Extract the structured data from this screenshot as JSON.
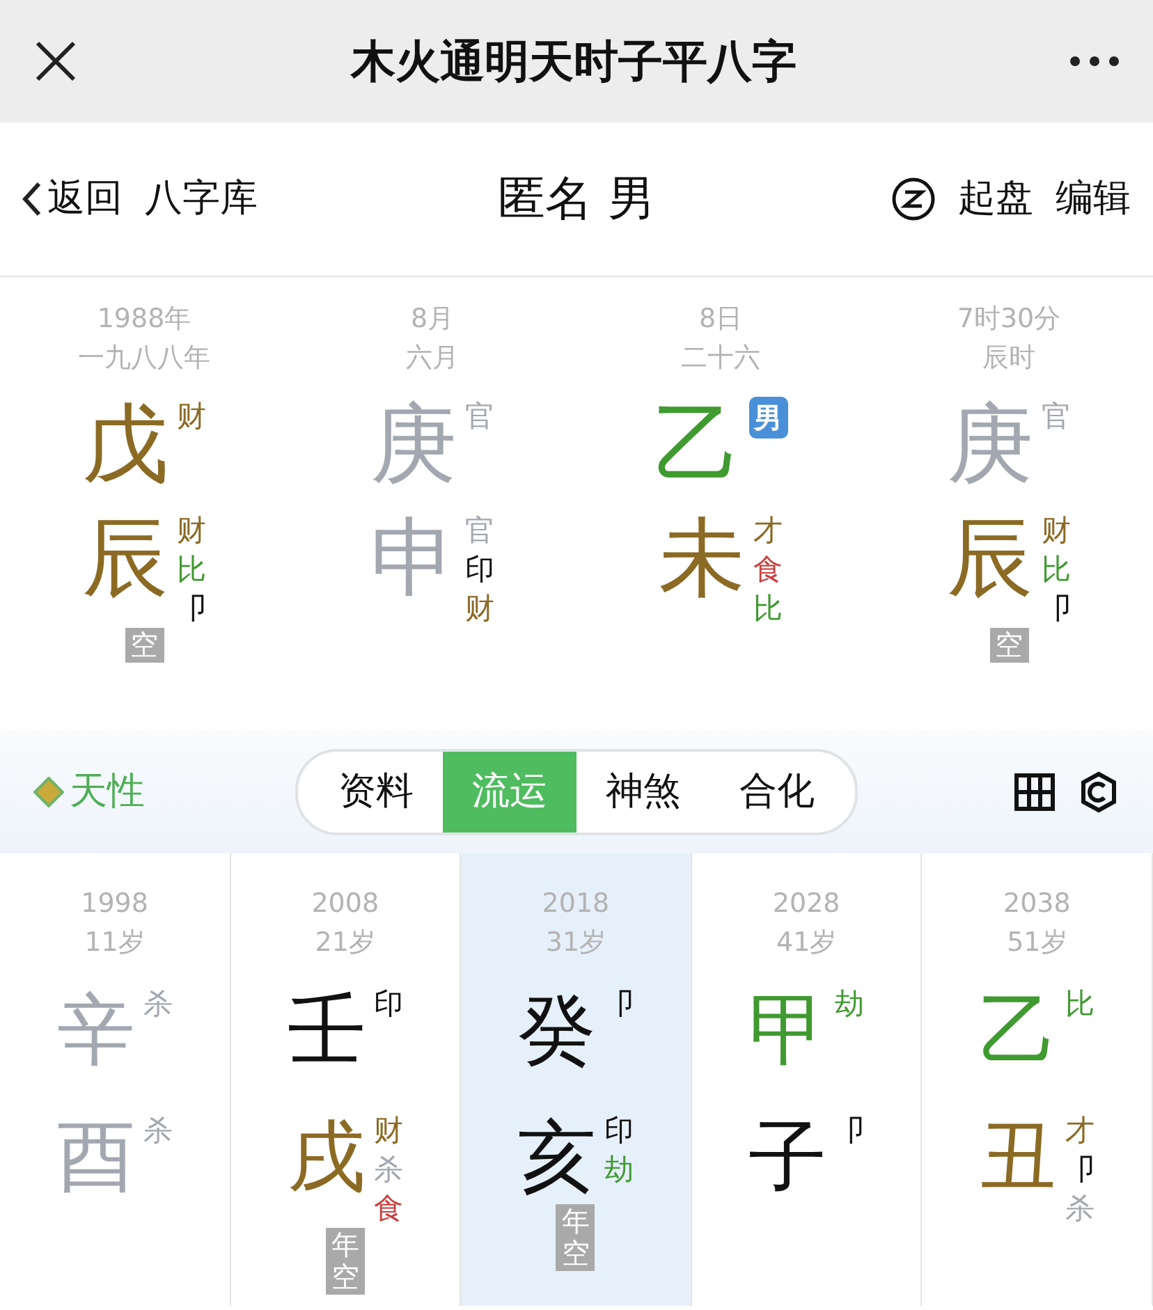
{
  "top_bar": {
    "title": "木火通明天时子平八字"
  },
  "nav": {
    "back": "返回",
    "library": "八字库",
    "title": "匿名 男",
    "actions": [
      "起盘",
      "编辑"
    ]
  },
  "pillars": [
    {
      "date": "1988年",
      "lunar": "一九八八年",
      "stem": {
        "char": "戊",
        "color": "#8b6a24",
        "gods": [
          {
            "text": "财",
            "color": "#8b6a24"
          }
        ]
      },
      "branch": {
        "char": "辰",
        "color": "#8b6a24",
        "gods": [
          {
            "text": "财",
            "color": "#8b6a24"
          },
          {
            "text": "比",
            "color": "#3f9a30"
          },
          {
            "text": "卩",
            "color": "#111111"
          }
        ]
      },
      "void": "空"
    },
    {
      "date": "8月",
      "lunar": "六月",
      "stem": {
        "char": "庚",
        "color": "#a3a8b0",
        "gods": [
          {
            "text": "官",
            "color": "#a3a8b0"
          }
        ]
      },
      "branch": {
        "char": "申",
        "color": "#a3a8b0",
        "gods": [
          {
            "text": "官",
            "color": "#a3a8b0"
          },
          {
            "text": "印",
            "color": "#111111"
          },
          {
            "text": "财",
            "color": "#8b6a24"
          }
        ]
      }
    },
    {
      "date": "8日",
      "lunar": "二十六",
      "stem": {
        "char": "乙",
        "color": "#3f9a30"
      },
      "badge": "男",
      "branch": {
        "char": "未",
        "color": "#8b6a24",
        "gods": [
          {
            "text": "才",
            "color": "#8b6a24"
          },
          {
            "text": "食",
            "color": "#c8403f"
          },
          {
            "text": "比",
            "color": "#3f9a30"
          }
        ]
      }
    },
    {
      "date": "7时30分",
      "lunar": "辰时",
      "stem": {
        "char": "庚",
        "color": "#a3a8b0",
        "gods": [
          {
            "text": "官",
            "color": "#a3a8b0"
          }
        ]
      },
      "branch": {
        "char": "辰",
        "color": "#8b6a24",
        "gods": [
          {
            "text": "财",
            "color": "#8b6a24"
          },
          {
            "text": "比",
            "color": "#3f9a30"
          },
          {
            "text": "卩",
            "color": "#111111"
          }
        ]
      },
      "void": "空"
    }
  ],
  "tab_bar": {
    "label": "天性",
    "tabs": [
      {
        "label": "资料",
        "selected": false
      },
      {
        "label": "流运",
        "selected": true
      },
      {
        "label": "神煞",
        "selected": false
      },
      {
        "label": "合化",
        "selected": false
      }
    ]
  },
  "luck": [
    {
      "year": "1998",
      "age": "11岁",
      "selected": false,
      "stem": {
        "char": "辛",
        "color": "#a3a8b0",
        "gods": [
          {
            "text": "杀",
            "color": "#a3a8b0"
          }
        ]
      },
      "branch": {
        "char": "酉",
        "color": "#a3a8b0",
        "gods": [
          {
            "text": "杀",
            "color": "#a3a8b0"
          }
        ]
      }
    },
    {
      "year": "2008",
      "age": "21岁",
      "selected": false,
      "stem": {
        "char": "壬",
        "color": "#111111",
        "gods": [
          {
            "text": "印",
            "color": "#111111"
          }
        ]
      },
      "branch": {
        "char": "戌",
        "color": "#8b6a24",
        "gods": [
          {
            "text": "财",
            "color": "#8b6a24"
          },
          {
            "text": "杀",
            "color": "#a3a8b0"
          },
          {
            "text": "食",
            "color": "#c8403f"
          }
        ]
      },
      "void": "年空"
    },
    {
      "year": "2018",
      "age": "31岁",
      "selected": true,
      "stem": {
        "char": "癸",
        "color": "#111111",
        "gods": [
          {
            "text": "卩",
            "color": "#111111"
          }
        ]
      },
      "branch": {
        "char": "亥",
        "color": "#111111",
        "gods": [
          {
            "text": "印",
            "color": "#111111"
          },
          {
            "text": "劫",
            "color": "#3f9a30"
          }
        ]
      },
      "void": "年空"
    },
    {
      "year": "2028",
      "age": "41岁",
      "selected": false,
      "stem": {
        "char": "甲",
        "color": "#3f9a30",
        "gods": [
          {
            "text": "劫",
            "color": "#3f9a30"
          }
        ]
      },
      "branch": {
        "char": "子",
        "color": "#111111",
        "gods": [
          {
            "text": "卩",
            "color": "#111111"
          }
        ]
      }
    },
    {
      "year": "2038",
      "age": "51岁",
      "selected": false,
      "stem": {
        "char": "乙",
        "color": "#3f9a30",
        "gods": [
          {
            "text": "比",
            "color": "#3f9a30"
          }
        ]
      },
      "branch": {
        "char": "丑",
        "color": "#8b6a24",
        "gods": [
          {
            "text": "才",
            "color": "#8b6a24"
          },
          {
            "text": "卩",
            "color": "#111111"
          },
          {
            "text": "杀",
            "color": "#a3a8b0"
          }
        ]
      }
    }
  ]
}
